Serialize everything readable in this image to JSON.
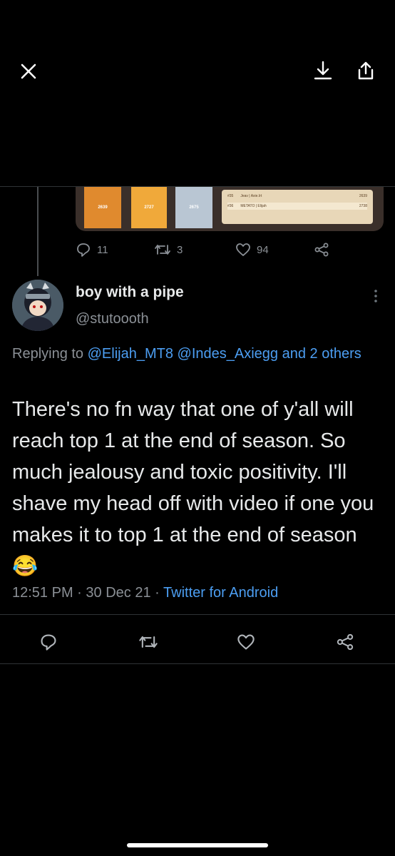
{
  "colors": {
    "background": "#000000",
    "link": "#4c9ef2",
    "muted": "#8b9096",
    "text": "#e7e9ea"
  },
  "topbar": {
    "close_icon": "close-icon",
    "download_icon": "download-icon",
    "share_icon": "share-icon"
  },
  "quoted_media": {
    "tiles": [
      "2639",
      "2727",
      "2675"
    ],
    "rows": [
      {
        "rank": "#35",
        "name": "Jeav | Axie.Irt",
        "score": "2639"
      },
      {
        "rank": "#36",
        "name": "METATO | Elijah",
        "score": "2738"
      }
    ]
  },
  "parent_stats": {
    "replies": "11",
    "retweets": "3",
    "likes": "94"
  },
  "tweet": {
    "display_name": "boy with a pipe",
    "handle": "@stutoooth",
    "replying_prefix": "Replying to ",
    "replying_mentions": "@Elijah_MT8 @Indes_Axiegg and 2 others",
    "text": "There's no fn way that one of y'all will reach top 1 at the end of season. So much jealousy and toxic positivity. I'll shave my head off with video if one you makes it to top 1 at the end of season 😂",
    "time": "12:51 PM",
    "separator": "·",
    "date": "30 Dec 21",
    "source": "Twitter for Android"
  },
  "actions": [
    "reply-icon",
    "retweet-icon",
    "like-icon",
    "share-icon"
  ]
}
